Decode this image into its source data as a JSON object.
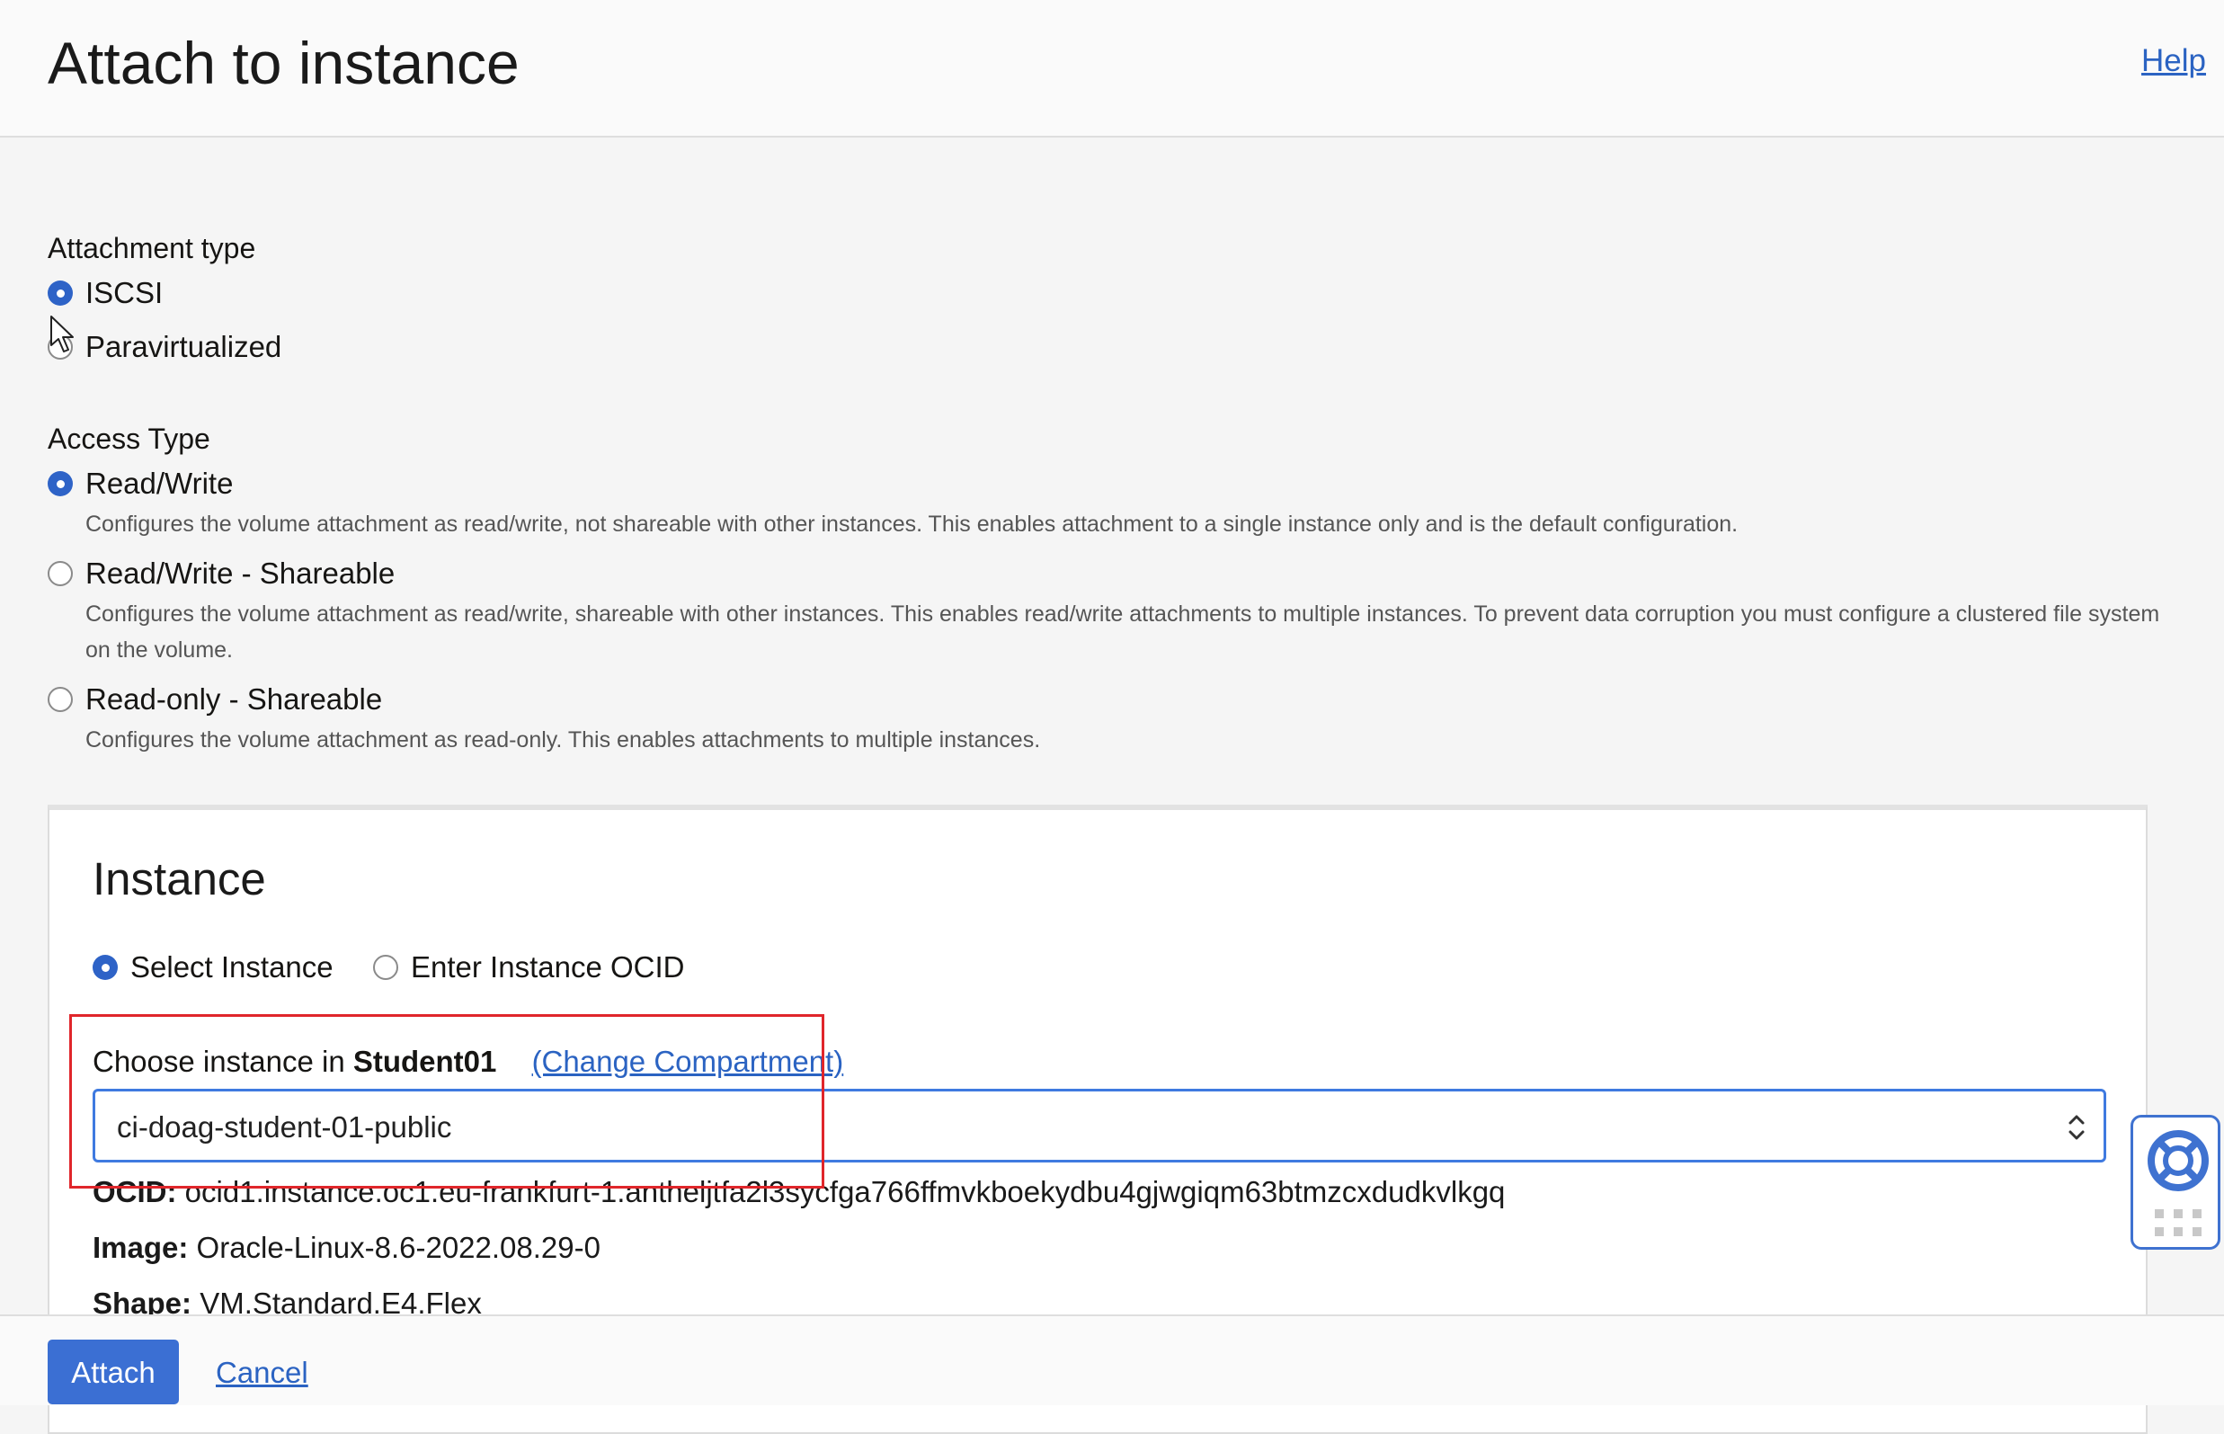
{
  "header": {
    "title": "Attach to instance",
    "help_label": "Help"
  },
  "attachment_type": {
    "label": "Attachment type",
    "options": [
      {
        "label": "ISCSI",
        "checked": true
      },
      {
        "label": "Paravirtualized",
        "checked": false
      }
    ]
  },
  "access_type": {
    "label": "Access Type",
    "options": [
      {
        "label": "Read/Write",
        "checked": true,
        "description": "Configures the volume attachment as read/write, not shareable with other instances. This enables attachment to a single instance only and is the default configuration."
      },
      {
        "label": "Read/Write - Shareable",
        "checked": false,
        "description": "Configures the volume attachment as read/write, shareable with other instances. This enables read/write attachments to multiple instances. To prevent data corruption you must configure a clustered file system on the volume."
      },
      {
        "label": "Read-only - Shareable",
        "checked": false,
        "description": "Configures the volume attachment as read-only. This enables attachments to multiple instances."
      }
    ]
  },
  "instance": {
    "title": "Instance",
    "mode_options": [
      {
        "label": "Select Instance",
        "checked": true
      },
      {
        "label": "Enter Instance OCID",
        "checked": false
      }
    ],
    "choose_prefix": "Choose instance in",
    "compartment": "Student01",
    "change_compartment_label": "(Change Compartment)",
    "selected_instance": "ci-doag-student-01-public",
    "details": {
      "ocid_label": "OCID:",
      "ocid_value": "ocid1.instance.oc1.eu-frankfurt-1.antheljtfa2l3sycfga766ffmvkboekydbu4gjwgiqm63btmzcxdudkvlkgq",
      "image_label": "Image:",
      "image_value": "Oracle-Linux-8.6-2022.08.29-0",
      "shape_label": "Shape:",
      "shape_value": "VM.Standard.E4.Flex"
    }
  },
  "footer": {
    "attach_label": "Attach",
    "cancel_label": "Cancel"
  },
  "colors": {
    "accent": "#3b6fd3",
    "link": "#2b63c2",
    "highlight": "#e0262b"
  }
}
